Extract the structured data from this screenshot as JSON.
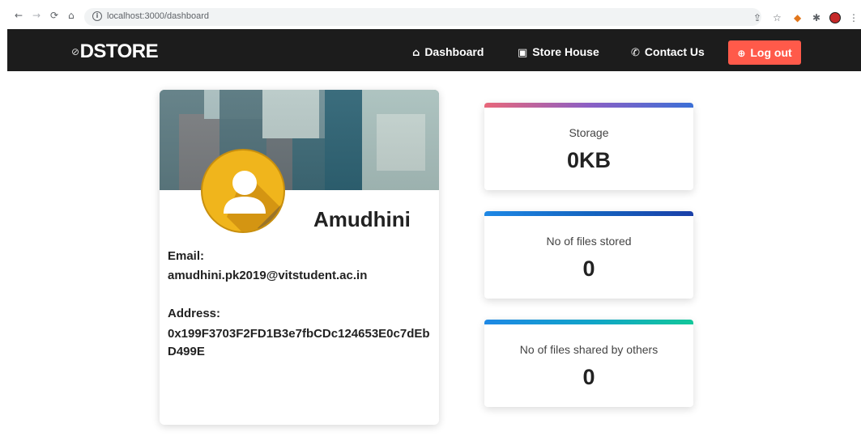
{
  "browser": {
    "url": "localhost:3000/dashboard",
    "info_icon": "i",
    "back_icon": "←",
    "forward_icon": "→",
    "reload_icon": "⟳",
    "home_icon": "⌂"
  },
  "navbar": {
    "brand": "DSTORE",
    "brand_icon": "⊘",
    "links": [
      {
        "label": "Dashboard",
        "icon": "⌂"
      },
      {
        "label": "Store House",
        "icon": "▣"
      },
      {
        "label": "Contact Us",
        "icon": "✆"
      }
    ],
    "logout": {
      "label": "Log out",
      "icon": "⊕"
    }
  },
  "profile": {
    "name": "Amudhini",
    "email_label": "Email:",
    "email": "amudhini.pk2019@vitstudent.ac.in",
    "address_label": "Address:",
    "address": "0x199F3703F2FD1B3e7fbCDc124653E0c7dEbD499E"
  },
  "stats": [
    {
      "label": "Storage",
      "value": "0KB",
      "bar_from": "#e8677a",
      "bar_mid": "#8b5fc4",
      "bar_to": "#3b6fd6"
    },
    {
      "label": "No of files stored",
      "value": "0",
      "bar_from": "#1e88e5",
      "bar_mid": "#1565c0",
      "bar_to": "#1a3fa8"
    },
    {
      "label": "No of files shared by others",
      "value": "0",
      "bar_from": "#1e88e5",
      "bar_mid": "#11a3c9",
      "bar_to": "#12c79a"
    }
  ],
  "colors": {
    "navbar_bg": "#1c1c1c",
    "logout_bg": "#ff5a4a",
    "avatar_bg": "#f0b51c"
  }
}
